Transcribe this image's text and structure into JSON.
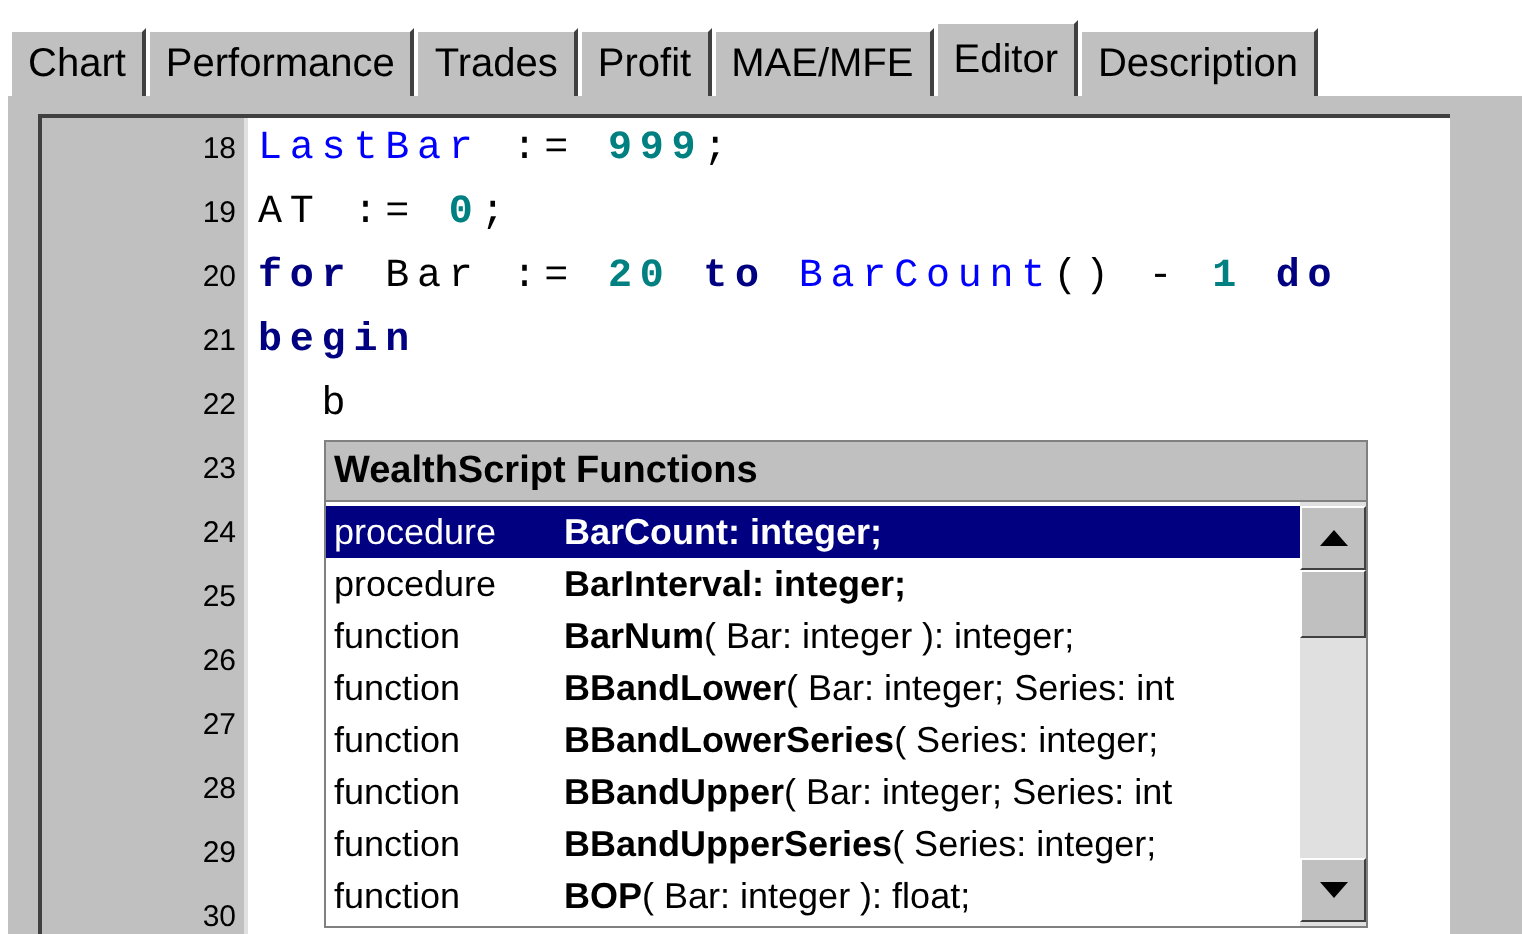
{
  "tabs": [
    {
      "label": "Chart",
      "selected": false
    },
    {
      "label": "Performance",
      "selected": false
    },
    {
      "label": "Trades",
      "selected": false
    },
    {
      "label": "Profit",
      "selected": false
    },
    {
      "label": "MAE/MFE",
      "selected": false
    },
    {
      "label": "Editor",
      "selected": true
    },
    {
      "label": "Description",
      "selected": false
    }
  ],
  "editor": {
    "lines": [
      {
        "number": "18",
        "tokens": [
          {
            "kind": "ident",
            "text": "LastBar"
          },
          {
            "kind": "plain",
            "text": " := "
          },
          {
            "kind": "number",
            "text": "999"
          },
          {
            "kind": "plain",
            "text": ";"
          }
        ]
      },
      {
        "number": "19",
        "tokens": [
          {
            "kind": "plain",
            "text": "AT := "
          },
          {
            "kind": "number",
            "text": "0"
          },
          {
            "kind": "plain",
            "text": ";"
          }
        ]
      },
      {
        "number": "20",
        "tokens": [
          {
            "kind": "keyword",
            "text": "for"
          },
          {
            "kind": "plain",
            "text": " Bar := "
          },
          {
            "kind": "number",
            "text": "20"
          },
          {
            "kind": "keyword",
            "text": " to "
          },
          {
            "kind": "ident",
            "text": "BarCount"
          },
          {
            "kind": "plain",
            "text": "() - "
          },
          {
            "kind": "number",
            "text": "1"
          },
          {
            "kind": "keyword",
            "text": " do"
          }
        ]
      },
      {
        "number": "21",
        "tokens": [
          {
            "kind": "keyword",
            "text": "begin"
          }
        ]
      },
      {
        "number": "22",
        "tokens": [
          {
            "kind": "plain",
            "text": "  b"
          }
        ]
      },
      {
        "number": "23"
      },
      {
        "number": "24"
      },
      {
        "number": "25"
      },
      {
        "number": "26"
      },
      {
        "number": "27"
      },
      {
        "number": "28"
      },
      {
        "number": "29"
      },
      {
        "number": "30"
      }
    ]
  },
  "completion": {
    "title": "WealthScript Functions",
    "items": [
      {
        "kind": "procedure",
        "name": "BarCount: integer;",
        "selected": true
      },
      {
        "kind": "procedure",
        "name": "BarInterval: integer;",
        "selected": false
      },
      {
        "kind": "function",
        "name": "BarNum",
        "signature": "( Bar: integer ): integer;",
        "selected": false
      },
      {
        "kind": "function",
        "name": "BBandLower",
        "signature": "( Bar: integer; Series: int",
        "selected": false
      },
      {
        "kind": "function",
        "name": "BBandLowerSeries",
        "signature": "( Series: integer;",
        "selected": false
      },
      {
        "kind": "function",
        "name": "BBandUpper",
        "signature": "( Bar: integer; Series: int",
        "selected": false
      },
      {
        "kind": "function",
        "name": "BBandUpperSeries",
        "signature": "( Series: integer;",
        "selected": false
      },
      {
        "kind": "function",
        "name": "BOP",
        "signature": "( Bar: integer ): float;",
        "selected": false
      }
    ]
  }
}
